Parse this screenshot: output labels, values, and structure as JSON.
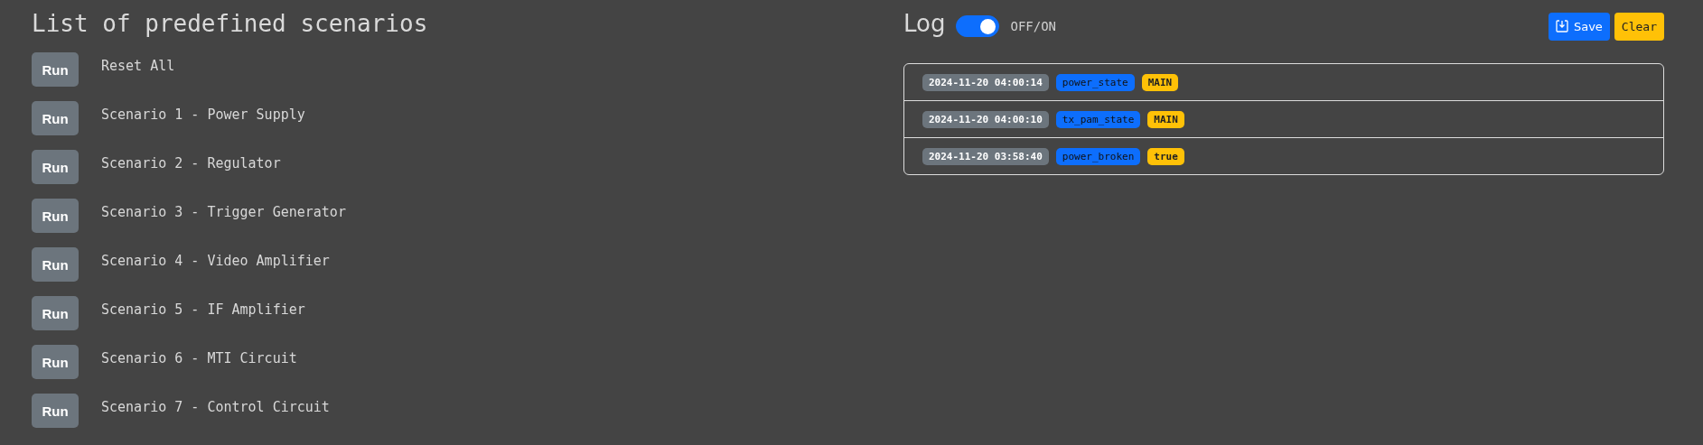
{
  "scenarios": {
    "title": "List of predefined scenarios",
    "items": [
      {
        "button": "Run",
        "label": "Reset All"
      },
      {
        "button": "Run",
        "label": "Scenario 1 - Power Supply"
      },
      {
        "button": "Run",
        "label": "Scenario 2 - Regulator"
      },
      {
        "button": "Run",
        "label": "Scenario 3 - Trigger Generator"
      },
      {
        "button": "Run",
        "label": "Scenario 4 - Video Amplifier"
      },
      {
        "button": "Run",
        "label": "Scenario 5 - IF Amplifier"
      },
      {
        "button": "Run",
        "label": "Scenario 6 - MTI Circuit"
      },
      {
        "button": "Run",
        "label": "Scenario 7 - Control Circuit"
      }
    ]
  },
  "log": {
    "title": "Log",
    "toggle": {
      "on": true,
      "label": "OFF/ON"
    },
    "buttons": [
      {
        "kind": "save",
        "label": "Save"
      },
      {
        "kind": "clear",
        "label": "Clear"
      }
    ],
    "entries": [
      {
        "time": "2024-11-20 04:00:14",
        "key": "power_state",
        "value": "MAIN"
      },
      {
        "time": "2024-11-20 04:00:10",
        "key": "tx_pam_state",
        "value": "MAIN"
      },
      {
        "time": "2024-11-20 03:58:40",
        "key": "power_broken",
        "value": "true"
      }
    ]
  }
}
